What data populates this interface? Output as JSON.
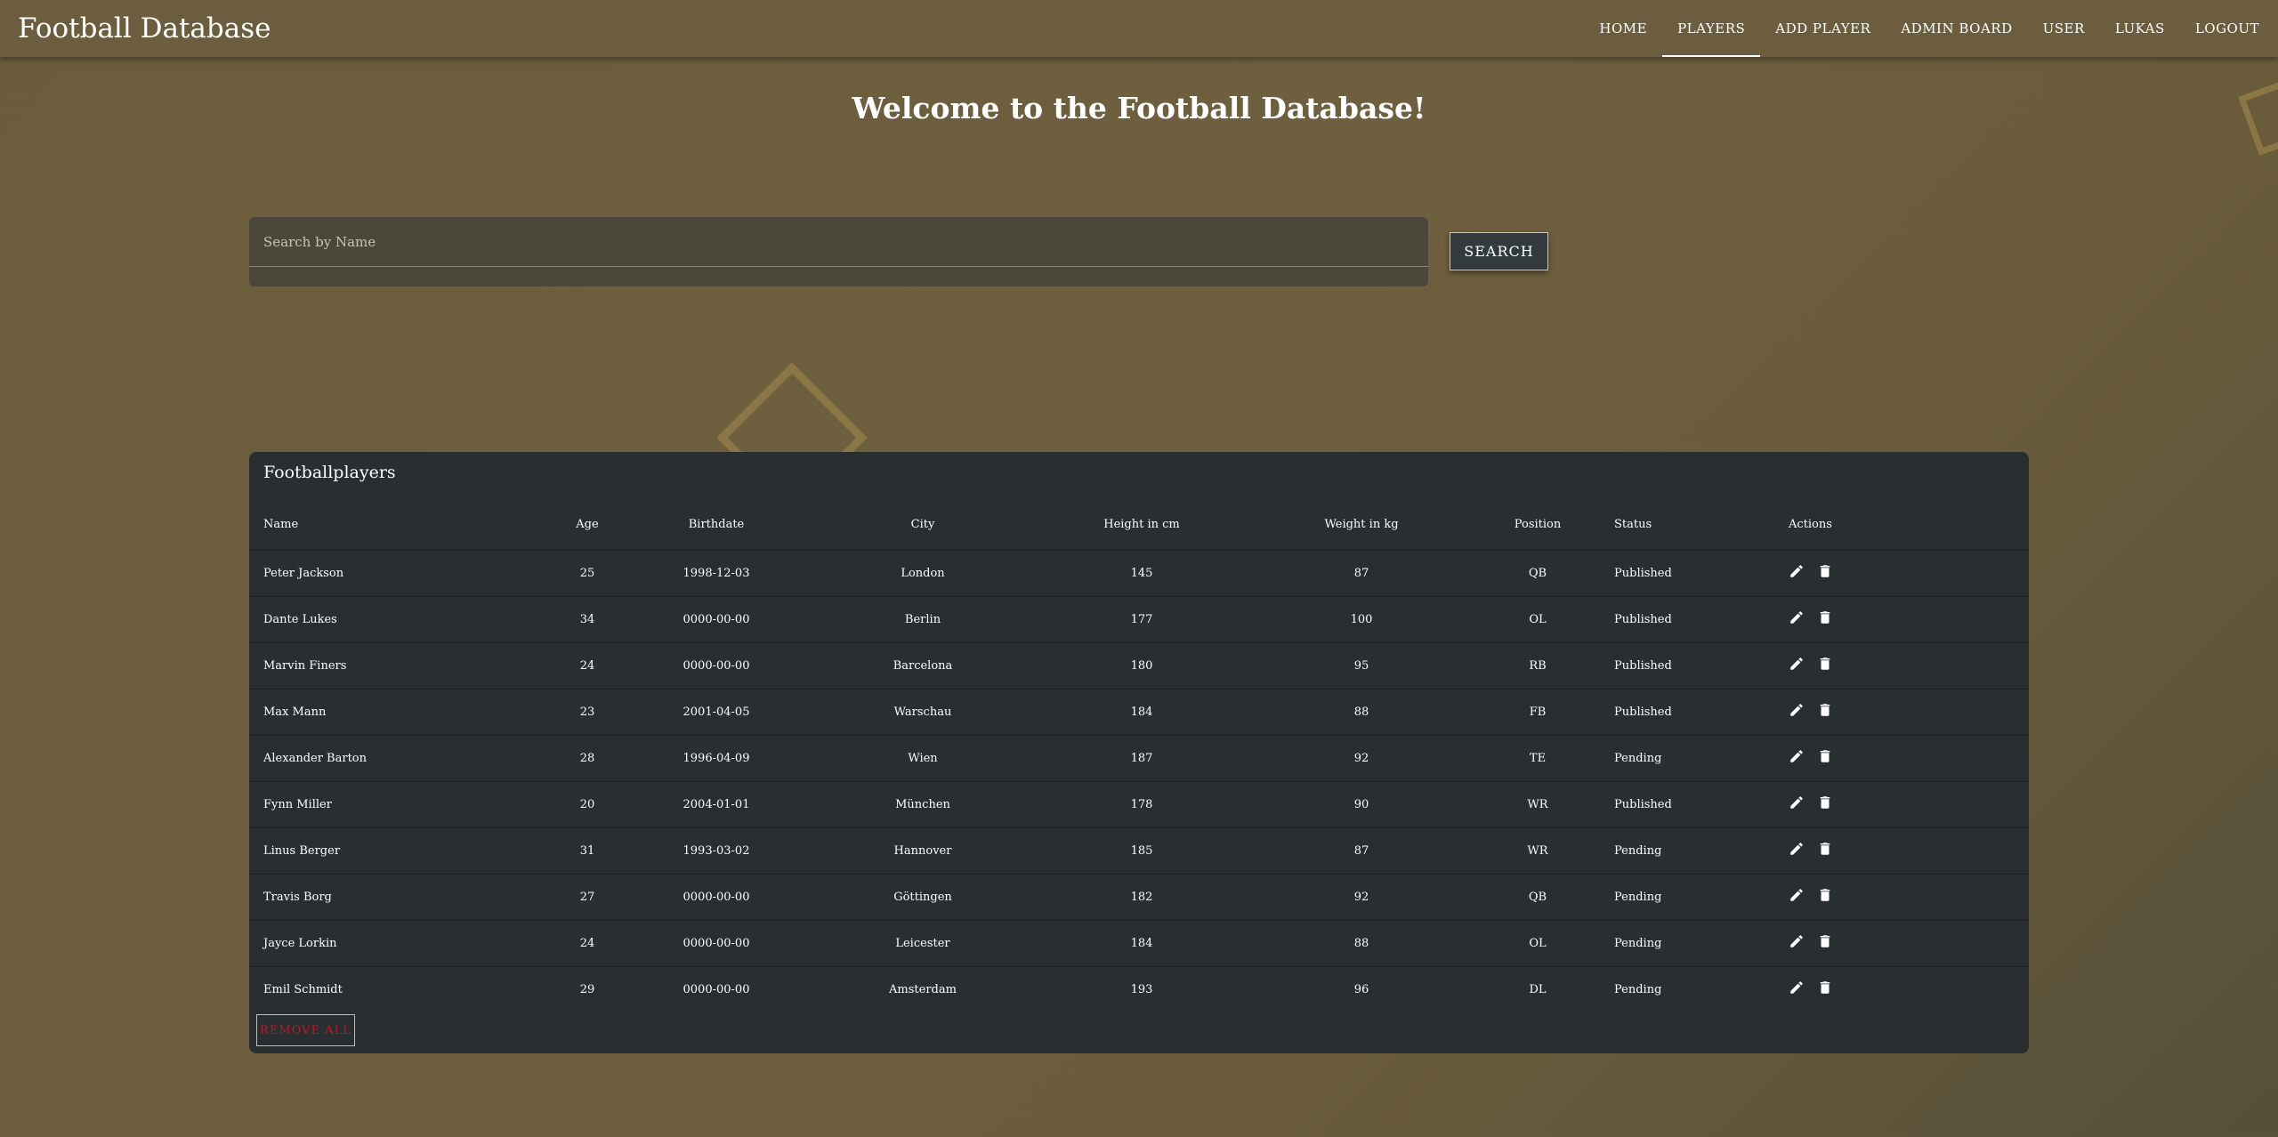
{
  "app": {
    "brand": "Football Database"
  },
  "nav": {
    "items": [
      {
        "label": "HOME",
        "active": false
      },
      {
        "label": "PLAYERS",
        "active": true
      },
      {
        "label": "ADD PLAYER",
        "active": false
      },
      {
        "label": "ADMIN BOARD",
        "active": false
      },
      {
        "label": "USER",
        "active": false
      },
      {
        "label": "LUKAS",
        "active": false
      },
      {
        "label": "LOGOUT",
        "active": false
      }
    ]
  },
  "main": {
    "welcome": "Welcome to the Football Database!"
  },
  "search": {
    "placeholder": "Search by Name",
    "value": "",
    "button_label": "SEARCH"
  },
  "table": {
    "title": "Footballplayers",
    "columns": [
      "Name",
      "Age",
      "Birthdate",
      "City",
      "Height in cm",
      "Weight in kg",
      "Position",
      "Status",
      "Actions"
    ],
    "rows": [
      [
        "Peter Jackson",
        "25",
        "1998-12-03",
        "London",
        "145",
        "87",
        "QB",
        "Published"
      ],
      [
        "Dante Lukes",
        "34",
        "0000-00-00",
        "Berlin",
        "177",
        "100",
        "OL",
        "Published"
      ],
      [
        "Marvin Finers",
        "24",
        "0000-00-00",
        "Barcelona",
        "180",
        "95",
        "RB",
        "Published"
      ],
      [
        "Max Mann",
        "23",
        "2001-04-05",
        "Warschau",
        "184",
        "88",
        "FB",
        "Published"
      ],
      [
        "Alexander Barton",
        "28",
        "1996-04-09",
        "Wien",
        "187",
        "92",
        "TE",
        "Pending"
      ],
      [
        "Fynn Miller",
        "20",
        "2004-01-01",
        "München",
        "178",
        "90",
        "WR",
        "Published"
      ],
      [
        "Linus Berger",
        "31",
        "1993-03-02",
        "Hannover",
        "185",
        "87",
        "WR",
        "Pending"
      ],
      [
        "Travis Borg",
        "27",
        "0000-00-00",
        "Göttingen",
        "182",
        "92",
        "QB",
        "Pending"
      ],
      [
        "Jayce Lorkin",
        "24",
        "0000-00-00",
        "Leicester",
        "184",
        "88",
        "OL",
        "Pending"
      ],
      [
        "Emil Schmidt",
        "29",
        "0000-00-00",
        "Amsterdam",
        "193",
        "96",
        "DL",
        "Pending"
      ]
    ],
    "row_action_icons": [
      "pencil-icon",
      "trash-icon"
    ],
    "remove_all_label": "REMOVE ALL"
  },
  "colors": {
    "background": "#6b5d3c",
    "panel": "#292e31",
    "remove_text": "#c2162f"
  }
}
